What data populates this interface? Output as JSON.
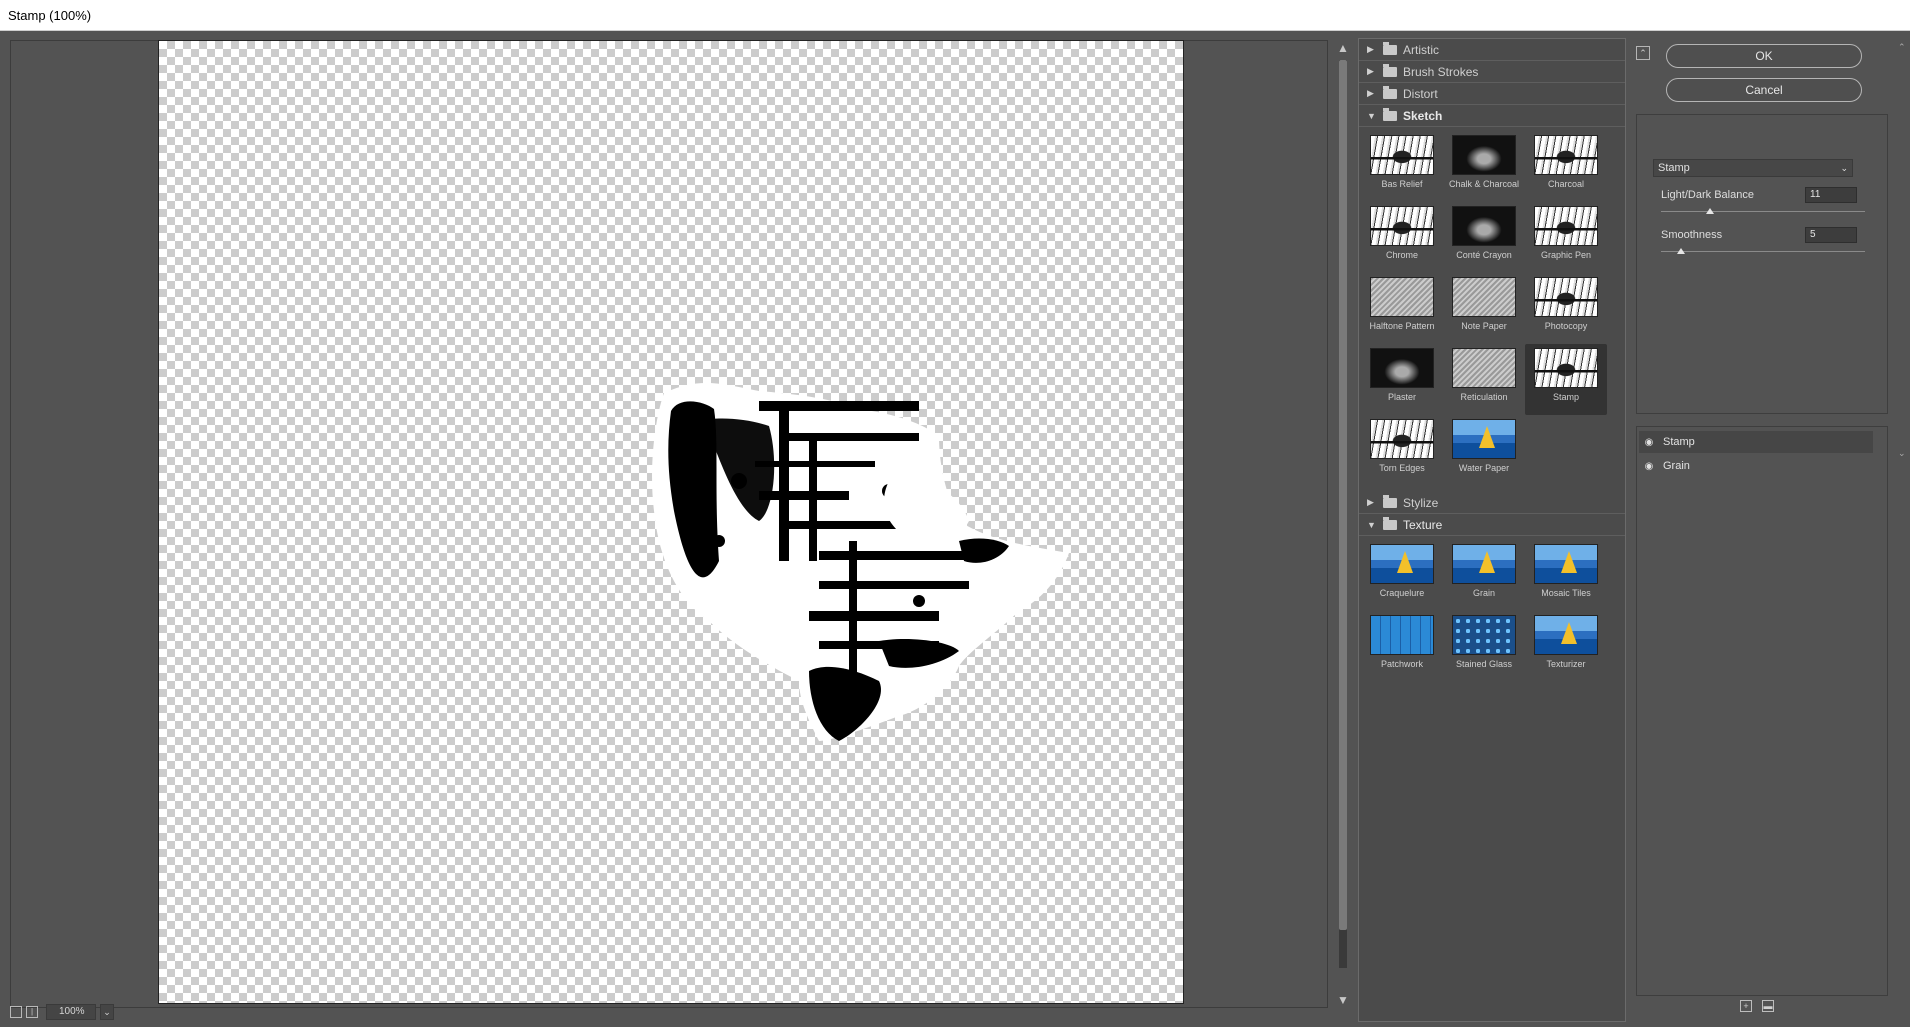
{
  "window": {
    "title": "Stamp (100%)"
  },
  "statusbar": {
    "zoom": "100%"
  },
  "gallery": {
    "categories": [
      {
        "name": "Artistic",
        "open": false
      },
      {
        "name": "Brush Strokes",
        "open": false
      },
      {
        "name": "Distort",
        "open": false
      },
      {
        "name": "Sketch",
        "open": true,
        "filters": [
          "Bas Relief",
          "Chalk & Charcoal",
          "Charcoal",
          "Chrome",
          "Conté Crayon",
          "Graphic Pen",
          "Halftone Pattern",
          "Note Paper",
          "Photocopy",
          "Plaster",
          "Reticulation",
          "Stamp",
          "Torn Edges",
          "Water Paper"
        ]
      },
      {
        "name": "Stylize",
        "open": false
      },
      {
        "name": "Texture",
        "open": true,
        "filters": [
          "Craquelure",
          "Grain",
          "Mosaic Tiles",
          "Patchwork",
          "Stained Glass",
          "Texturizer"
        ]
      }
    ],
    "selected_filter": "Stamp"
  },
  "buttons": {
    "ok": "OK",
    "cancel": "Cancel"
  },
  "settings": {
    "filter_select": "Stamp",
    "params": [
      {
        "label": "Light/Dark Balance",
        "value": "11",
        "fraction": 0.24
      },
      {
        "label": "Smoothness",
        "value": "5",
        "fraction": 0.1
      }
    ]
  },
  "layers": [
    {
      "name": "Stamp",
      "active": true
    },
    {
      "name": "Grain",
      "active": false
    }
  ],
  "icons": {
    "folder": "folder-icon",
    "expanded": "triangle-down-icon",
    "collapsed": "triangle-right-icon",
    "eye": "eye-icon",
    "new_layer": "new-layer-icon",
    "delete_layer": "trash-icon"
  }
}
